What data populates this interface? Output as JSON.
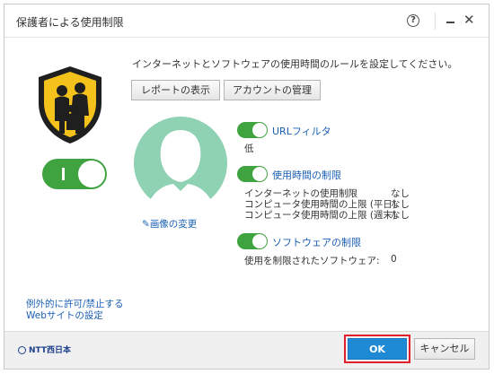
{
  "window": {
    "title": "保護者による使用制限"
  },
  "intro_text": "インターネットとソフトウェアの使用時間のルールを設定してください。",
  "buttons": {
    "report": "レポートの表示",
    "account": "アカウントの管理",
    "ok": "OK",
    "cancel": "キャンセル"
  },
  "change_image_label": "画像の変更",
  "url_filter": {
    "label": "URLフィルタ",
    "level": "低"
  },
  "time_limits": {
    "label": "使用時間の制限",
    "rows": [
      {
        "label": "インターネットの使用制限",
        "value": "なし"
      },
      {
        "label": "コンピュータ使用時間の上限 (平日)",
        "value": "なし"
      },
      {
        "label": "コンピュータ使用時間の上限 (週末)",
        "value": "なし"
      }
    ]
  },
  "software_limits": {
    "label": "ソフトウェアの制限",
    "row_label": "使用を制限されたソフトウェア:",
    "row_value": "0"
  },
  "exceptions_link": {
    "line1": "例外的に許可/禁止する",
    "line2": "Webサイトの設定"
  },
  "brand": "NTT西日本",
  "colors": {
    "accent_blue": "#1e8ad6",
    "toggle_green": "#3fa33f",
    "shield_yellow": "#f5c21b",
    "highlight_red": "#e0202a"
  },
  "icons": {
    "help": "help-icon",
    "minimize": "minimize-icon",
    "close": "close-icon",
    "shield": "family-shield-icon",
    "avatar": "user-avatar-icon",
    "pencil": "pencil-icon"
  }
}
